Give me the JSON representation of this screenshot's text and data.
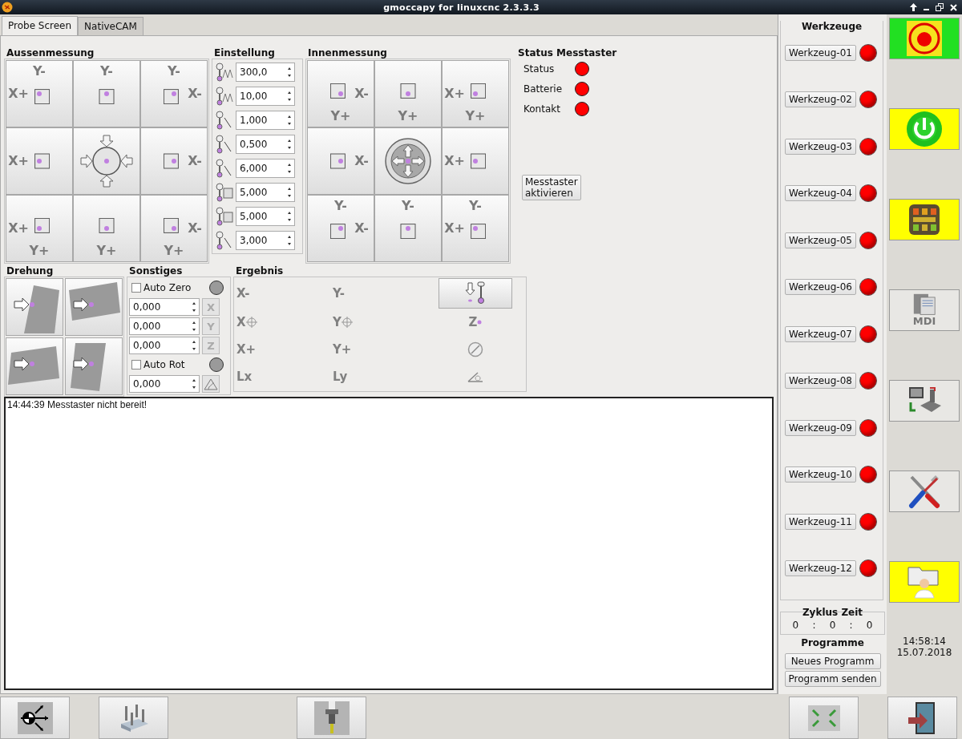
{
  "window": {
    "title": "gmoccapy for linuxcnc  2.3.3.3"
  },
  "tabs": [
    {
      "label": "Probe Screen",
      "selected": true
    },
    {
      "label": "NativeCAM",
      "selected": false
    }
  ],
  "outside": {
    "title": "Aussenmessung",
    "buttons": [
      {
        "kind": "corner",
        "y_label": "Y-",
        "x_label": "X+"
      },
      {
        "kind": "edge",
        "y_label": "Y-"
      },
      {
        "kind": "corner",
        "y_label": "Y-",
        "x_label": "X-"
      },
      {
        "kind": "edge",
        "x_label": "X+"
      },
      {
        "kind": "center"
      },
      {
        "kind": "edge",
        "x_label": "X-"
      },
      {
        "kind": "corner",
        "x_label": "X+",
        "y_label": "Y+"
      },
      {
        "kind": "edge",
        "y_label": "Y+"
      },
      {
        "kind": "corner",
        "x_label": "X-",
        "y_label": "Y+"
      }
    ]
  },
  "settings": {
    "title": "Einstellung",
    "fields": [
      {
        "value": "300,0"
      },
      {
        "value": "10,00"
      },
      {
        "value": "1,000"
      },
      {
        "value": "0,500"
      },
      {
        "value": "6,000"
      },
      {
        "value": "5,000"
      },
      {
        "value": "5,000"
      },
      {
        "value": "3,000"
      }
    ]
  },
  "inside": {
    "title": "Innenmessung",
    "buttons": [
      {
        "kind": "corner",
        "x_label": "X-",
        "y_label": "Y+"
      },
      {
        "kind": "edge",
        "y_label": "Y+"
      },
      {
        "kind": "corner",
        "x_label": "X+",
        "y_label": "Y+"
      },
      {
        "kind": "edge",
        "x_label": "X-"
      },
      {
        "kind": "center"
      },
      {
        "kind": "edge",
        "x_label": "X+"
      },
      {
        "kind": "corner",
        "y_label": "Y-",
        "x_label": "X-"
      },
      {
        "kind": "edge",
        "y_label": "Y-"
      },
      {
        "kind": "corner",
        "y_label": "Y-",
        "x_label": "X+"
      }
    ]
  },
  "probe_status": {
    "title": "Status Messtaster",
    "items": [
      {
        "label": "Status",
        "color": "#ff0000"
      },
      {
        "label": "Batterie",
        "color": "#ff0000"
      },
      {
        "label": "Kontakt",
        "color": "#ff0000"
      }
    ],
    "button": "Messtaster\naktivieren"
  },
  "rotation": {
    "title": "Drehung",
    "buttons": [
      {
        "kind": "left"
      },
      {
        "kind": "top"
      },
      {
        "kind": "bottom"
      },
      {
        "kind": "right"
      }
    ]
  },
  "misc": {
    "title": "Sonstiges",
    "rows": [
      {
        "kind": "check",
        "label": "Auto Zero",
        "checked": false,
        "led_on": false
      },
      {
        "kind": "spin",
        "value": "0,000",
        "button": "X"
      },
      {
        "kind": "spin",
        "value": "0,000",
        "button": "Y"
      },
      {
        "kind": "spin",
        "value": "0,000",
        "button": "Z"
      },
      {
        "kind": "check",
        "label": "Auto Rot",
        "checked": false,
        "led_on": false
      },
      {
        "kind": "spin",
        "value": "0,000"
      }
    ]
  },
  "result": {
    "title": "Ergebnis",
    "items": [
      {
        "kind": "text",
        "text": "X-"
      },
      {
        "kind": "text",
        "text": "Y-"
      },
      {
        "kind": "button"
      },
      {
        "kind": "center",
        "text": "X"
      },
      {
        "kind": "center",
        "text": "Y"
      },
      {
        "kind": "height",
        "text": "Z"
      },
      {
        "kind": "text",
        "text": "X+"
      },
      {
        "kind": "text",
        "text": "Y+"
      },
      {
        "kind": "diameter"
      },
      {
        "kind": "text",
        "text": "Lx"
      },
      {
        "kind": "text",
        "text": "Ly"
      },
      {
        "kind": "angle"
      }
    ]
  },
  "log": [
    "14:44:39  Messtaster nicht bereit!"
  ],
  "tools": {
    "title": "Werkzeuge",
    "items": [
      {
        "label": "Werkzeug-01",
        "color": "#ff0000"
      },
      {
        "label": "Werkzeug-02",
        "color": "#ff0000"
      },
      {
        "label": "Werkzeug-03",
        "color": "#ff0000"
      },
      {
        "label": "Werkzeug-04",
        "color": "#ff0000"
      },
      {
        "label": "Werkzeug-05",
        "color": "#ff0000"
      },
      {
        "label": "Werkzeug-06",
        "color": "#ff0000"
      },
      {
        "label": "Werkzeug-07",
        "color": "#ff0000"
      },
      {
        "label": "Werkzeug-08",
        "color": "#ff0000"
      },
      {
        "label": "Werkzeug-09",
        "color": "#ff0000"
      },
      {
        "label": "Werkzeug-10",
        "color": "#ff0000"
      },
      {
        "label": "Werkzeug-11",
        "color": "#ff0000"
      },
      {
        "label": "Werkzeug-12",
        "color": "#ff0000"
      }
    ]
  },
  "cycle_time": {
    "title": "Zyklus Zeit",
    "parts": [
      "0",
      ":",
      "0",
      ":",
      "0"
    ]
  },
  "programs": {
    "title": "Programme",
    "buttons": [
      "Neues Programm",
      "Programm senden"
    ]
  },
  "side_buttons": [
    {
      "kind": "estop",
      "color": "#22e022"
    },
    {
      "kind": "power",
      "color": "#ffff00"
    },
    {
      "kind": "jog",
      "color": "#ffff00"
    },
    {
      "kind": "mdi",
      "color": "#e8e7e4",
      "label": "MDI"
    },
    {
      "kind": "auto",
      "color": "#e8e7e4"
    },
    {
      "kind": "settings",
      "color": "#e8e7e4"
    },
    {
      "kind": "user",
      "color": "#ffff00"
    }
  ],
  "clock": {
    "time": "14:58:14",
    "date": "15.07.2018"
  },
  "bottom_buttons": [
    {
      "kind": "origin"
    },
    {
      "kind": "tools"
    },
    {
      "kind": "spindle"
    },
    {
      "kind": "fullscreen"
    },
    {
      "kind": "exit"
    }
  ]
}
